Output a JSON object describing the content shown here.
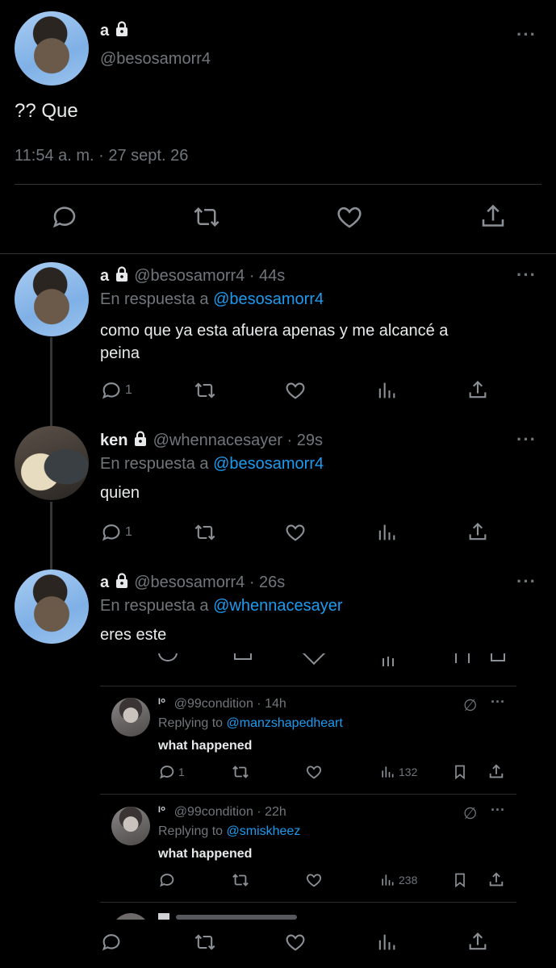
{
  "main": {
    "name": "a",
    "handle": "@besosamorr4",
    "text": "?? Que",
    "timestamp": "11:54 a. m. · 27 sept. 26"
  },
  "replies": [
    {
      "name": "a",
      "handle": "@besosamorr4",
      "time": "· 44s",
      "reply_prefix": "En respuesta a",
      "reply_to": "@besosamorr4",
      "text_line1": "como que ya esta afuera apenas y me alcancé a",
      "text_line2": "peina",
      "reply_count": "1"
    },
    {
      "name": "ken",
      "handle": "@whennacesayer",
      "time": "· 29s",
      "reply_prefix": "En respuesta a",
      "reply_to": "@besosamorr4",
      "text": "quien",
      "reply_count": "1"
    },
    {
      "name": "a",
      "handle": "@besosamorr4",
      "time": "· 26s",
      "reply_prefix": "En respuesta a",
      "reply_to": "@whennacesayer",
      "text": "eres este"
    }
  ],
  "embedded": [
    {
      "handle": "@99condition",
      "time": "· 14h",
      "reply_prefix": "Replying to",
      "reply_to": "@manzshapedheart",
      "text": "what happened",
      "reply_count": "1",
      "views": "132"
    },
    {
      "handle": "@99condition",
      "time": "· 22h",
      "reply_prefix": "Replying to",
      "reply_to": "@smiskheez",
      "text": "what happened",
      "reply_count": "",
      "views": "238"
    }
  ],
  "colors": {
    "link": "#1d9bf0",
    "muted": "#71767b",
    "background": "#000000"
  }
}
